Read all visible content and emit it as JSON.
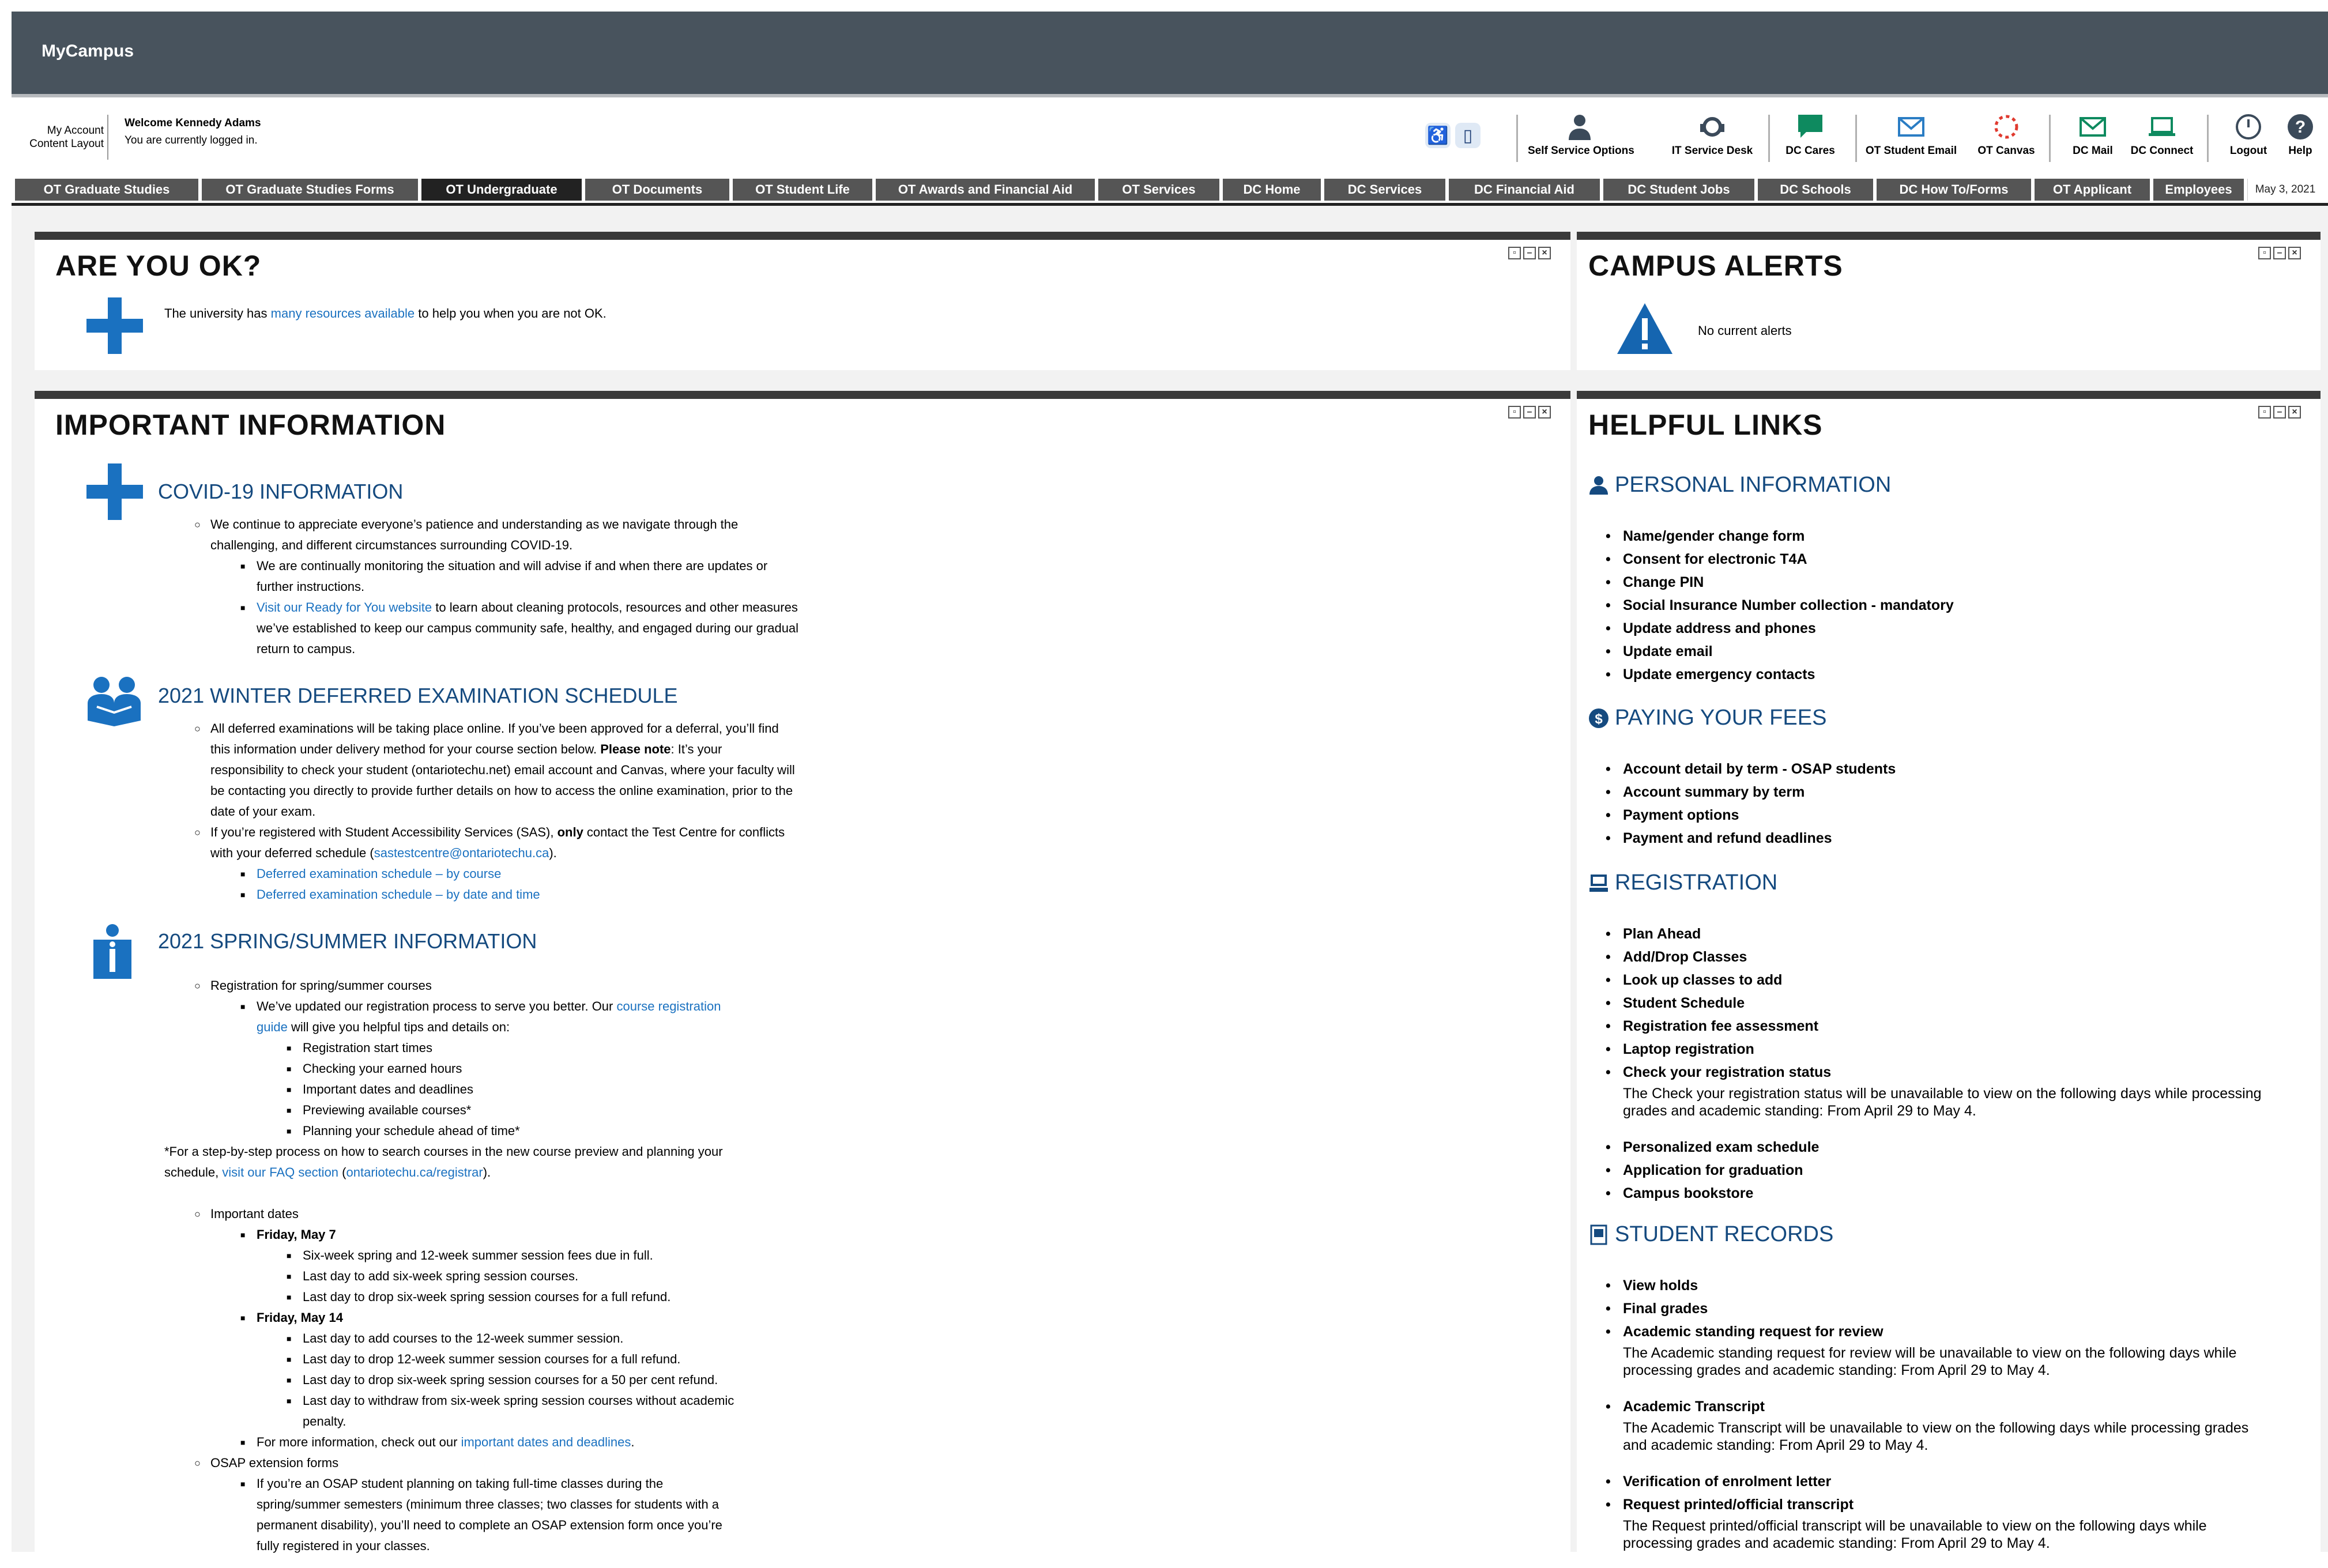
{
  "app": {
    "title": "MyCampus"
  },
  "account": {
    "my_account": "My Account",
    "content_layout": "Content Layout",
    "welcome": "Welcome Kennedy Adams",
    "status": "You are currently logged in."
  },
  "utilities": [
    {
      "label": "Self Service Options",
      "icon": "person-icon"
    },
    {
      "label": "IT Service Desk",
      "icon": "headset-icon"
    },
    {
      "label": "DC Cares",
      "icon": "chat-icon"
    },
    {
      "label": "OT Student Email",
      "icon": "envelope-icon"
    },
    {
      "label": "OT Canvas",
      "icon": "canvas-icon"
    },
    {
      "label": "DC Mail",
      "icon": "mail-icon"
    },
    {
      "label": "DC Connect",
      "icon": "laptop-icon"
    },
    {
      "label": "Logout",
      "icon": "power-icon"
    },
    {
      "label": "Help",
      "icon": "help-icon"
    }
  ],
  "tabs": [
    "OT Graduate Studies",
    "OT Graduate Studies Forms",
    "OT Undergraduate",
    "OT Documents",
    "OT Student Life",
    "OT Awards and Financial Aid",
    "OT Services",
    "DC Home",
    "DC Services",
    "DC Financial Aid",
    "DC Student Jobs",
    "DC Schools",
    "DC How To/Forms",
    "OT Applicant",
    "Employees"
  ],
  "active_tab": "OT Undergraduate",
  "date": "May 3, 2021",
  "colors": {
    "header": "#48535d",
    "accent": "#1a71c0",
    "heading_blue": "#154a7f",
    "alert": "#1565b0"
  },
  "are_you_ok": {
    "title": "ARE YOU OK?",
    "text_before": "The university has",
    "link": "many resources available",
    "text_after": "to help you when you are not OK."
  },
  "campus_alerts": {
    "title": "CAMPUS ALERTS",
    "text": "No current alerts"
  },
  "important": {
    "title": "IMPORTANT INFORMATION",
    "covid": {
      "heading": "COVID-19 INFORMATION",
      "p1a": "We continue to appreciate everyone’s patience and understanding as we navigate through the",
      "p1b": "challenging, and different circumstances surrounding COVID-19.",
      "p2a": "We are continually monitoring the situation and will advise if and when there are updates or",
      "p2b": "further instructions.",
      "p3_link": "Visit our Ready for You website",
      "p3a": " to learn about cleaning protocols, resources and other measures",
      "p3b": "we’ve established to keep our campus community safe, healthy, and engaged during our gradual",
      "p3c": "return to campus."
    },
    "winter": {
      "heading": "2021 WINTER DEFERRED EXAMINATION SCHEDULE",
      "l1": "All deferred examinations will be taking place online. If you’ve been approved for a deferral, you’ll find",
      "l2a": "this information under delivery method for your course section below. ",
      "l2b": "Please note",
      "l2c": ": It’s your",
      "l3": "responsibility to check your student (ontariotechu.net) email account and Canvas, where your faculty will",
      "l4": "be contacting you directly to provide further details on how to access the online examination, prior to the",
      "l5": "date of your exam.",
      "l6a": "If you’re registered with Student Accessibility Services (SAS), ",
      "l6b": "only",
      "l6c": " contact the Test Centre for conflicts",
      "l7a": "with your deferred schedule (",
      "l7_link": "sastestcentre@ontariotechu.ca",
      "l7b": ").",
      "link1": "Deferred examination schedule – by course",
      "link2": "Deferred examination schedule – by date and time"
    },
    "spring": {
      "heading": "2021 SPRING/SUMMER INFORMATION",
      "reg": "Registration for spring/summer courses",
      "reg1a": "We’ve updated our registration process to serve you better. Our ",
      "reg1_link_a": "course registration",
      "reg1_link_b": "guide",
      "reg1b": " will give you helpful tips and details on:",
      "items": [
        "Registration start times",
        "Checking your earned hours",
        "Important dates and deadlines",
        "Previewing available courses*",
        "Planning your schedule ahead of time*"
      ],
      "foot_a": "*For a step-by-step process on how to search courses in the new course preview and planning your",
      "foot_b": "schedule, ",
      "foot_link1": "visit our FAQ section",
      "foot_c": " (",
      "foot_link2": "ontariotechu.ca/registrar",
      "foot_d": ").",
      "dates": "Important dates",
      "may7": "Friday, May 7",
      "may7_items": [
        "Six-week spring and 12-week summer session fees due in full.",
        "Last day to add six-week spring session courses.",
        "Last day to drop six-week spring session courses for a full refund."
      ],
      "may14": "Friday, May 14",
      "may14_items": [
        "Last day to add courses to the 12-week summer session.",
        "Last day to drop 12-week summer session courses for a full refund.",
        "Last day to drop six-week spring session courses for a 50 per cent refund.",
        "Last day to withdraw from six-week spring session courses without academic"
      ],
      "may14_last_b": "penalty.",
      "more_a": "For more information, check out our ",
      "more_link": "important dates and deadlines",
      "more_b": ".",
      "osap": "OSAP extension forms",
      "osap1": "If you’re an OSAP student planning on taking full-time classes during the",
      "osap2": "spring/summer semesters (minimum three classes; two classes for students with a",
      "osap3": "permanent disability), you’ll need to complete an OSAP extension form once you’re",
      "osap4": "fully registered in your classes."
    }
  },
  "helpful": {
    "title": "HELPFUL LINKS",
    "personal": {
      "heading": "PERSONAL INFORMATION",
      "items": [
        "Name/gender change form",
        "Consent for electronic T4A",
        "Change PIN",
        "Social Insurance Number collection - mandatory",
        "Update address and phones",
        "Update email",
        "Update emergency contacts"
      ]
    },
    "fees": {
      "heading": "PAYING YOUR FEES",
      "items": [
        "Account detail by term - OSAP students",
        "Account summary by term",
        "Payment options",
        "Payment and refund deadlines"
      ]
    },
    "registration": {
      "heading": "REGISTRATION",
      "items": [
        "Plan Ahead",
        "Add/Drop Classes",
        "Look up classes to add",
        "Student Schedule",
        "Registration fee assessment",
        "Laptop registration",
        "Check your registration status"
      ],
      "note": "The Check your registration status will be unavailable to view on the following days while processing grades and academic standing: From April 29 to May 4.",
      "items2": [
        "Personalized exam schedule",
        "Application for graduation",
        "Campus bookstore"
      ]
    },
    "records": {
      "heading": "STUDENT RECORDS",
      "items": [
        "View holds",
        "Final grades",
        "Academic standing request for review"
      ],
      "note1": "The Academic standing request for review will be unavailable to view on the following days while processing grades and academic standing: From April 29 to May 4.",
      "item4": "Academic Transcript",
      "note2": "The Academic Transcript will be unavailable to view on the following days while processing grades and academic standing: From April 29 to May 4.",
      "item5": "Verification of enrolment letter",
      "item6": "Request printed/official transcript",
      "note3": "The Request printed/official transcript will be unavailable to view on the following days while processing grades and academic standing: From April 29 to May 4."
    }
  }
}
